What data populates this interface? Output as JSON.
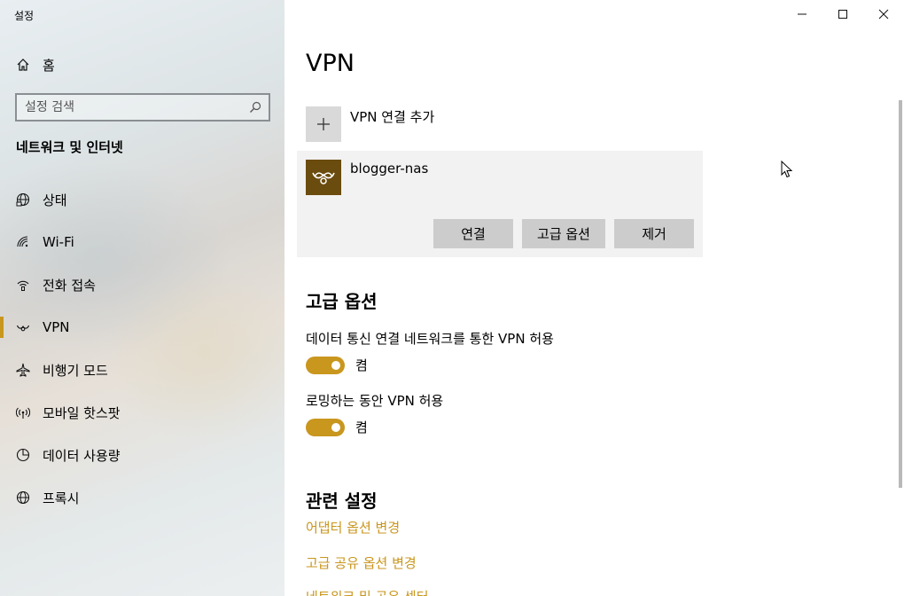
{
  "window": {
    "title": "설정"
  },
  "sidebar": {
    "home_label": "홈",
    "search_placeholder": "설정 검색",
    "section_title": "네트워크 및 인터넷",
    "items": [
      {
        "label": "상태",
        "icon": "globe-status-icon"
      },
      {
        "label": "Wi-Fi",
        "icon": "wifi-icon"
      },
      {
        "label": "전화 접속",
        "icon": "dialup-icon"
      },
      {
        "label": "VPN",
        "icon": "vpn-icon",
        "active": true
      },
      {
        "label": "비행기 모드",
        "icon": "airplane-icon"
      },
      {
        "label": "모바일 핫스팟",
        "icon": "hotspot-icon"
      },
      {
        "label": "데이터 사용량",
        "icon": "data-usage-icon"
      },
      {
        "label": "프록시",
        "icon": "globe-icon"
      }
    ]
  },
  "main": {
    "title": "VPN",
    "add_label": "VPN 연결 추가",
    "connection": {
      "name": "blogger-nas",
      "connect_label": "연결",
      "advanced_label": "고급 옵션",
      "remove_label": "제거"
    },
    "advanced": {
      "title": "고급 옵션",
      "options": [
        {
          "label": "데이터 통신 연결 네트워크를 통한 VPN 허용",
          "state": "켬",
          "on": true
        },
        {
          "label": "로밍하는 동안 VPN 허용",
          "state": "켬",
          "on": true
        }
      ]
    },
    "related": {
      "title": "관련 설정",
      "links": [
        "어댑터 옵션 변경",
        "고급 공유 옵션 변경",
        "네트워크 및 공유 센터"
      ]
    }
  },
  "colors": {
    "accent": "#c9961e",
    "vpn_logo_bg": "#6b4c0f"
  }
}
